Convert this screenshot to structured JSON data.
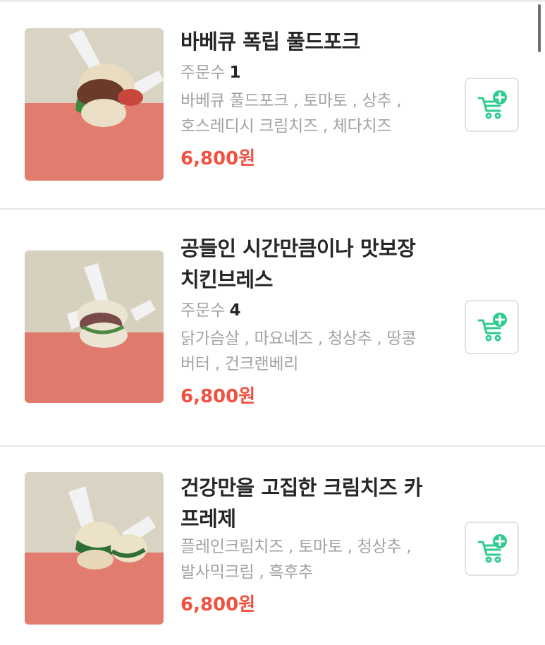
{
  "menu_items": [
    {
      "title_lines": [
        "바베큐 폭립 풀드포크"
      ],
      "orders_label": "주문수",
      "orders_count": "1",
      "ingredient_lines": [
        "바베큐 풀드포크 , 토마토 , 상추 ,",
        "호스레디시 크림치즈 , 체다치즈"
      ],
      "price": "6,800원",
      "image_icon": "sandwich-photo",
      "cart_icon": "cart-plus-icon"
    },
    {
      "title_lines": [
        "공들인 시간만큼이나 맛보장",
        "치킨브레스"
      ],
      "orders_label": "주문수",
      "orders_count": "4",
      "ingredient_lines": [
        "닭가슴살 , 마요네즈 , 청상추 , 땅콩",
        "버터 , 건크랜베리"
      ],
      "price": "6,800원",
      "image_icon": "sandwich-photo",
      "cart_icon": "cart-plus-icon"
    },
    {
      "title_lines": [
        "건강만을 고집한 크림치즈 카",
        "프레제"
      ],
      "ingredient_lines": [
        "플레인크림치즈 , 토마토 , 청상추 ,",
        "발사믹크림 , 흑후추"
      ],
      "price": "6,800원",
      "image_icon": "sandwich-photo",
      "cart_icon": "cart-plus-icon"
    }
  ],
  "colors": {
    "price": "#f2513f",
    "cart_accent": "#2ecc8f",
    "title": "#262626",
    "muted": "#a3a3a3",
    "photo_wall": "#d8d2c2",
    "photo_floor": "#e07a6d"
  }
}
